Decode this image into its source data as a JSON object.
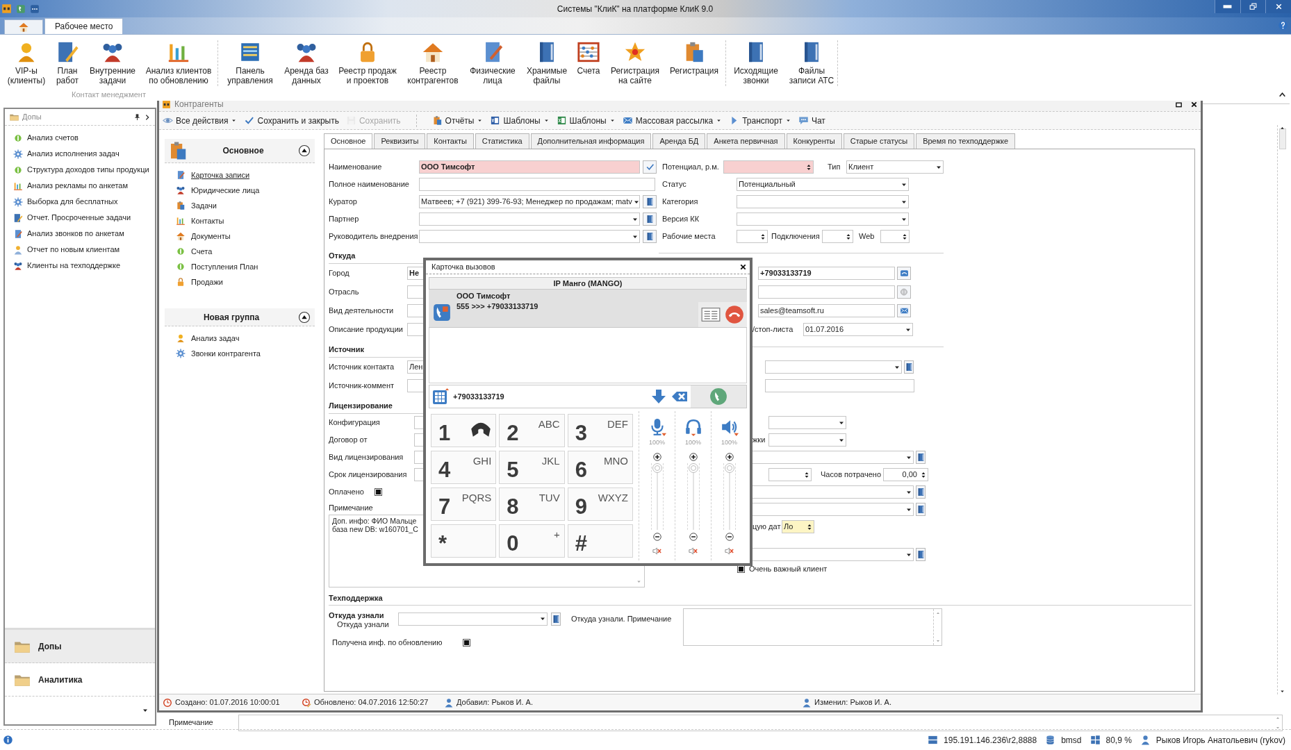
{
  "app": {
    "title": "Системы \"КлиК\" на платформе КлиК 9.0",
    "tabs": [
      {
        "label": "Рабочее место",
        "selected": true
      }
    ]
  },
  "ribbon": {
    "items": [
      {
        "label": "VIP-ы\n(клиенты)"
      },
      {
        "label": "План\nработ"
      },
      {
        "label": "Внутренние\nзадачи"
      },
      {
        "label": "Анализ клиентов\nпо обновлению"
      },
      {
        "label": "Панель\nуправления"
      },
      {
        "label": "Аренда баз\nданных"
      },
      {
        "label": "Реестр продаж\nи проектов"
      },
      {
        "label": "Реестр\nконтрагентов"
      },
      {
        "label": "Физические\nлица"
      },
      {
        "label": "Хранимые\nфайлы"
      },
      {
        "label": "Счета"
      },
      {
        "label": "Регистрация\nна сайте"
      },
      {
        "label": "Регистрация"
      },
      {
        "label": "Исходящие\nзвонки"
      },
      {
        "label": "Файлы\nзаписи АТС"
      }
    ],
    "group_label": "Контакт менеджмент"
  },
  "side_panel": {
    "title": "Допы",
    "items": [
      "Анализ счетов",
      "Анализ исполнения задач",
      "Структура доходов типы продукци",
      "Анализ рекламы по анкетам",
      "Выборка для бесплатных",
      "Отчет. Просроченные задачи",
      "Анализ звонков по анкетам",
      "Отчет по новым клиентам",
      "Клиенты на техподдержке"
    ],
    "groups": [
      {
        "label": "Допы",
        "selected": true
      },
      {
        "label": "Аналитика",
        "selected": false
      }
    ]
  },
  "record_window": {
    "title": "Контрагенты",
    "toolbar": [
      {
        "label": "Все действия",
        "menu": true,
        "disabled": false
      },
      {
        "label": "Сохранить и закрыть",
        "menu": false,
        "disabled": false
      },
      {
        "label": "Сохранить",
        "menu": false,
        "disabled": true
      },
      {
        "label": "Отчёты",
        "menu": true,
        "disabled": false
      },
      {
        "label": "Шаблоны",
        "menu": true,
        "disabled": false
      },
      {
        "label": "Шаблоны",
        "menu": true,
        "disabled": false
      },
      {
        "label": "Массовая рассылка",
        "menu": true,
        "disabled": false
      },
      {
        "label": "Транспорт",
        "menu": true,
        "disabled": false
      },
      {
        "label": "Чат",
        "menu": false,
        "disabled": false
      }
    ],
    "nav_groups": [
      {
        "title": "Основное",
        "expanded": true,
        "items": [
          {
            "label": "Карточка записи",
            "selected": true
          },
          {
            "label": "Юридические лица",
            "selected": false
          },
          {
            "label": "Задачи",
            "selected": false
          },
          {
            "label": "Контакты",
            "selected": false
          },
          {
            "label": "Документы",
            "selected": false
          },
          {
            "label": "Счета",
            "selected": false
          },
          {
            "label": "Поступления План",
            "selected": false
          },
          {
            "label": "Продажи",
            "selected": false
          }
        ]
      },
      {
        "title": "Новая группа",
        "expanded": true,
        "items": [
          {
            "label": "Анализ задач",
            "selected": false
          },
          {
            "label": "Звонки контрагента",
            "selected": false
          }
        ]
      }
    ],
    "tabs": [
      {
        "label": "Основное",
        "selected": true
      },
      {
        "label": "Реквизиты",
        "selected": false
      },
      {
        "label": "Контакты",
        "selected": false
      },
      {
        "label": "Статистика",
        "selected": false
      },
      {
        "label": "Дополнительная информация",
        "selected": false
      },
      {
        "label": "Аренда БД",
        "selected": false
      },
      {
        "label": "Анкета первичная",
        "selected": false
      },
      {
        "label": "Конкуренты",
        "selected": false
      },
      {
        "label": "Старые статусы",
        "selected": false
      },
      {
        "label": "Время по техподдержке",
        "selected": false
      }
    ],
    "form": {
      "left": [
        {
          "kind": "field",
          "label": "Наименование",
          "parts": [
            {
              "kind": "text",
              "value": "ООО Тимсофт",
              "required": true,
              "bold": true
            },
            {
              "kind": "button"
            }
          ]
        },
        {
          "kind": "field",
          "label": "Полное наименование",
          "parts": [
            {
              "kind": "text"
            }
          ]
        },
        {
          "kind": "field",
          "label": "Куратор",
          "parts": [
            {
              "kind": "combo",
              "value": "Матвеев; +7 (921) 399-76-93; Менеджер по продажам; matv"
            },
            {
              "kind": "button"
            }
          ]
        },
        {
          "kind": "field",
          "label": "Партнер",
          "parts": [
            {
              "kind": "combo"
            },
            {
              "kind": "button"
            }
          ]
        },
        {
          "kind": "field",
          "label": "Руководитель внедрения",
          "parts": [
            {
              "kind": "combo"
            },
            {
              "kind": "button"
            }
          ]
        },
        {
          "kind": "section",
          "label": "Откуда"
        },
        {
          "kind": "field",
          "label": "Город",
          "parts": [
            {
              "kind": "text",
              "value": "Не",
              "bold": true
            }
          ]
        },
        {
          "kind": "field",
          "label": "Отрасль",
          "parts": [
            {
              "kind": "text"
            }
          ]
        },
        {
          "kind": "field",
          "label": "Вид деятельности",
          "parts": [
            {
              "kind": "text"
            }
          ]
        },
        {
          "kind": "field",
          "label": "Описание продукции",
          "parts": [
            {
              "kind": "text"
            }
          ]
        },
        {
          "kind": "section",
          "label": "Источник"
        },
        {
          "kind": "field",
          "label": "Источник контакта",
          "parts": [
            {
              "kind": "text",
              "value": "Лен"
            }
          ]
        },
        {
          "kind": "field",
          "label": "Источник-коммент",
          "parts": [
            {
              "kind": "text"
            }
          ]
        },
        {
          "kind": "section",
          "label": "Лицензирование"
        },
        {
          "kind": "field",
          "label": "Конфигурация",
          "parts": [
            {
              "kind": "text"
            }
          ]
        },
        {
          "kind": "field",
          "label": "Договор от",
          "parts": [
            {
              "kind": "text"
            }
          ]
        },
        {
          "kind": "field",
          "label": "Вид лицензирования",
          "parts": [
            {
              "kind": "text"
            }
          ]
        },
        {
          "kind": "field",
          "label": "Срок лицензирования",
          "parts": [
            {
              "kind": "text"
            }
          ]
        },
        {
          "kind": "field",
          "label": "Оплачено",
          "parts": [
            {
              "kind": "checkbox",
              "checked": true
            }
          ]
        },
        {
          "kind": "label",
          "label": "Примечание"
        },
        {
          "kind": "memo",
          "lines": [
            "Доп. инфо: ФИО Мальце",
            "база new DB: w160701_C"
          ]
        }
      ],
      "right": [
        {
          "kind": "field",
          "parts": [
            {
              "kind": "label",
              "text": "Потенциал, р.м."
            },
            {
              "kind": "spin",
              "required": true
            },
            {
              "kind": "label",
              "text": "Тип"
            },
            {
              "kind": "combo",
              "value": "Клиент"
            }
          ]
        },
        {
          "kind": "field",
          "parts": [
            {
              "kind": "label",
              "text": "Статус"
            },
            {
              "kind": "combo",
              "value": "Потенциальный"
            }
          ]
        },
        {
          "kind": "field",
          "parts": [
            {
              "kind": "label",
              "text": "Категория"
            },
            {
              "kind": "combo"
            }
          ]
        },
        {
          "kind": "field",
          "parts": [
            {
              "kind": "label",
              "text": "Версия КК"
            },
            {
              "kind": "combo"
            }
          ]
        },
        {
          "kind": "field",
          "parts": [
            {
              "kind": "label",
              "text": "Рабочие места"
            },
            {
              "kind": "spin"
            },
            {
              "kind": "label",
              "text": "Подключения"
            },
            {
              "kind": "spin"
            },
            {
              "kind": "label",
              "text": "Web"
            },
            {
              "kind": "spin"
            }
          ]
        },
        {
          "kind": "divider"
        },
        {
          "kind": "field",
          "parts": [
            {
              "kind": "text",
              "value": "+79033133719",
              "bold": true
            },
            {
              "kind": "button"
            }
          ]
        },
        {
          "kind": "field",
          "parts": [
            {
              "kind": "text"
            },
            {
              "kind": "button"
            }
          ]
        },
        {
          "kind": "field",
          "parts": [
            {
              "kind": "text",
              "value": "sales@teamsoft.ru"
            },
            {
              "kind": "button"
            }
          ]
        },
        {
          "kind": "field",
          "parts": [
            {
              "kind": "label",
              "text": "/стоп-листа"
            },
            {
              "kind": "combo",
              "value": "01.07.2016"
            }
          ]
        },
        {
          "kind": "divider"
        },
        {
          "kind": "field",
          "parts": [
            {
              "kind": "combo"
            },
            {
              "kind": "button"
            }
          ]
        },
        {
          "kind": "field",
          "parts": [
            {
              "kind": "text"
            }
          ]
        },
        {
          "kind": "field",
          "parts": [
            {
              "kind": "combo"
            }
          ]
        },
        {
          "kind": "field",
          "parts": [
            {
              "kind": "label",
              "text": "жки"
            },
            {
              "kind": "combo"
            }
          ]
        },
        {
          "kind": "field",
          "parts": [
            {
              "kind": "combo"
            },
            {
              "kind": "button"
            }
          ]
        },
        {
          "kind": "field",
          "parts": [
            {
              "kind": "spin"
            },
            {
              "kind": "label",
              "text": "Часов потрачено"
            },
            {
              "kind": "spin",
              "value": "0,00"
            }
          ]
        },
        {
          "kind": "field",
          "parts": [
            {
              "kind": "combo"
            },
            {
              "kind": "button"
            }
          ]
        },
        {
          "kind": "field",
          "parts": [
            {
              "kind": "combo"
            },
            {
              "kind": "button"
            }
          ]
        },
        {
          "kind": "field",
          "parts": [
            {
              "kind": "label",
              "text": "цую дат"
            },
            {
              "kind": "spin",
              "value": "Ло",
              "highlighted": true
            }
          ]
        },
        {
          "kind": "field",
          "parts": [
            {
              "kind": "combo"
            },
            {
              "kind": "button"
            }
          ]
        },
        {
          "kind": "field",
          "parts": [
            {
              "kind": "checkbox",
              "checked": true
            },
            {
              "kind": "label",
              "text": "Очень важный клиент"
            }
          ]
        }
      ],
      "support": {
        "title": "Техподдержка",
        "source_title": "Откуда узнали",
        "source_label": "Откуда узнали",
        "note_label": "Откуда узнали. Примечание",
        "update_label": "Получена инф. по обновлению",
        "update_checked": true
      }
    },
    "status": [
      "Создано: 01.07.2016 10:00:01",
      "Обновлено: 04.07.2016 12:50:27",
      "Добавил: Рыков И. А.",
      "Изменил: Рыков И. А."
    ]
  },
  "call_dialog": {
    "title": "Карточка вызовов",
    "line": "IP Манго (MANGO)",
    "call": {
      "name": "ООО Тимсофт",
      "route": "555 >>> +79033133719"
    },
    "number": "+79033133719",
    "keys": [
      {
        "digit": "1",
        "kind": "icon"
      },
      {
        "digit": "2",
        "kind": "letters",
        "letters": "ABC"
      },
      {
        "digit": "3",
        "kind": "letters",
        "letters": "DEF"
      },
      {
        "digit": "4",
        "kind": "letters",
        "letters": "GHI"
      },
      {
        "digit": "5",
        "kind": "letters",
        "letters": "JKL"
      },
      {
        "digit": "6",
        "kind": "letters",
        "letters": "MNO"
      },
      {
        "digit": "7",
        "kind": "letters",
        "letters": "PQRS"
      },
      {
        "digit": "8",
        "kind": "letters",
        "letters": "TUV"
      },
      {
        "digit": "9",
        "kind": "letters",
        "letters": "WXYZ"
      },
      {
        "digit": "*",
        "kind": "plain"
      },
      {
        "digit": "0",
        "kind": "letters",
        "letters": "+"
      },
      {
        "digit": "#",
        "kind": "plain"
      }
    ],
    "volumes": [
      {
        "reading": "100%",
        "level": 1
      },
      {
        "reading": "100%",
        "level": 1
      },
      {
        "reading": "100%",
        "level": 1
      }
    ]
  },
  "note_label": "Примечание",
  "status_bar": [
    "195.191.146.236\\r2,8888",
    "bmsd",
    "80,9 %",
    "Рыков Игорь Анатольевич (rykov)"
  ]
}
